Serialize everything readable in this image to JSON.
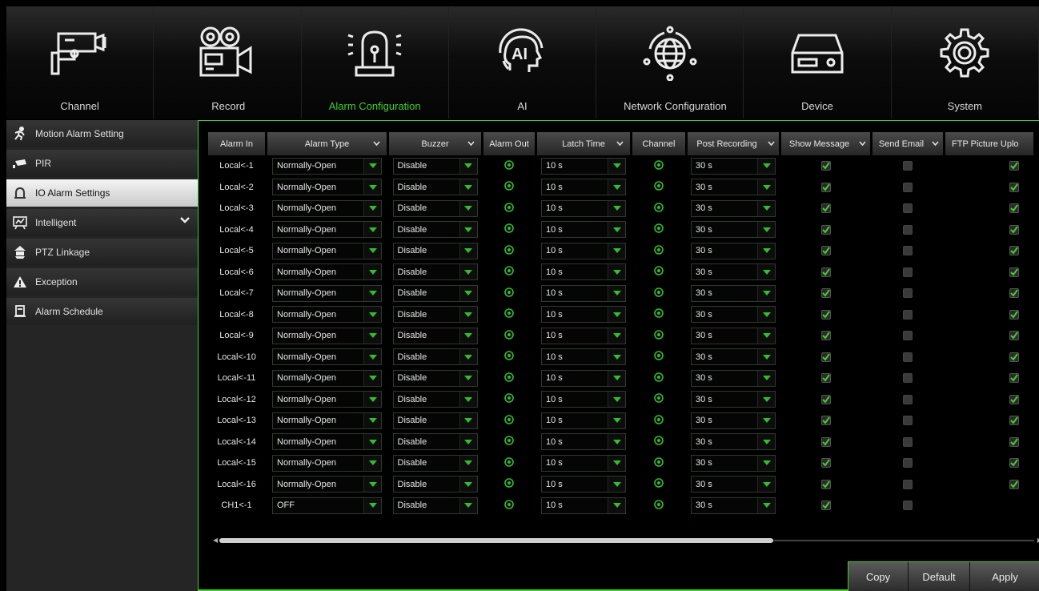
{
  "nav": {
    "tabs": [
      {
        "label": "Channel",
        "icon": "cctv-camera-icon"
      },
      {
        "label": "Record",
        "icon": "film-camera-icon"
      },
      {
        "label": "Alarm Configuration",
        "icon": "alarm-siren-icon"
      },
      {
        "label": "AI",
        "icon": "ai-head-icon"
      },
      {
        "label": "Network Configuration",
        "icon": "network-globe-icon"
      },
      {
        "label": "Device",
        "icon": "hard-drive-icon"
      },
      {
        "label": "System",
        "icon": "gear-icon"
      }
    ],
    "active": "Alarm Configuration",
    "accent": "#3fcf2a"
  },
  "sidebar": {
    "items": [
      {
        "label": "Motion Alarm Setting",
        "icon": "running-person-icon"
      },
      {
        "label": "PIR",
        "icon": "pir-sensor-icon"
      },
      {
        "label": "IO Alarm Settings",
        "icon": "io-alarm-icon"
      },
      {
        "label": "Intelligent",
        "icon": "intelligent-icon"
      },
      {
        "label": "PTZ Linkage",
        "icon": "ptz-icon"
      },
      {
        "label": "Exception",
        "icon": "warning-icon"
      },
      {
        "label": "Alarm Schedule",
        "icon": "schedule-icon"
      }
    ],
    "active": "IO Alarm Settings"
  },
  "table": {
    "headers": {
      "alarm_in": "Alarm In",
      "alarm_type": "Alarm Type",
      "buzzer": "Buzzer",
      "alarm_out": "Alarm Out",
      "latch_time": "Latch Time",
      "channel": "Channel",
      "post_recording": "Post Recording",
      "show_message": "Show Message",
      "send_email": "Send Email",
      "ftp_picture_upload": "FTP Picture Uplo"
    },
    "rows": [
      {
        "alarm_in": "Local<-1",
        "alarm_type": "Normally-Open",
        "buzzer": "Disable",
        "latch_time": "10 s",
        "post_recording": "30 s",
        "show_message": true,
        "send_email": false,
        "ftp": true
      },
      {
        "alarm_in": "Local<-2",
        "alarm_type": "Normally-Open",
        "buzzer": "Disable",
        "latch_time": "10 s",
        "post_recording": "30 s",
        "show_message": true,
        "send_email": false,
        "ftp": true
      },
      {
        "alarm_in": "Local<-3",
        "alarm_type": "Normally-Open",
        "buzzer": "Disable",
        "latch_time": "10 s",
        "post_recording": "30 s",
        "show_message": true,
        "send_email": false,
        "ftp": true
      },
      {
        "alarm_in": "Local<-4",
        "alarm_type": "Normally-Open",
        "buzzer": "Disable",
        "latch_time": "10 s",
        "post_recording": "30 s",
        "show_message": true,
        "send_email": false,
        "ftp": true
      },
      {
        "alarm_in": "Local<-5",
        "alarm_type": "Normally-Open",
        "buzzer": "Disable",
        "latch_time": "10 s",
        "post_recording": "30 s",
        "show_message": true,
        "send_email": false,
        "ftp": true
      },
      {
        "alarm_in": "Local<-6",
        "alarm_type": "Normally-Open",
        "buzzer": "Disable",
        "latch_time": "10 s",
        "post_recording": "30 s",
        "show_message": true,
        "send_email": false,
        "ftp": true
      },
      {
        "alarm_in": "Local<-7",
        "alarm_type": "Normally-Open",
        "buzzer": "Disable",
        "latch_time": "10 s",
        "post_recording": "30 s",
        "show_message": true,
        "send_email": false,
        "ftp": true
      },
      {
        "alarm_in": "Local<-8",
        "alarm_type": "Normally-Open",
        "buzzer": "Disable",
        "latch_time": "10 s",
        "post_recording": "30 s",
        "show_message": true,
        "send_email": false,
        "ftp": true
      },
      {
        "alarm_in": "Local<-9",
        "alarm_type": "Normally-Open",
        "buzzer": "Disable",
        "latch_time": "10 s",
        "post_recording": "30 s",
        "show_message": true,
        "send_email": false,
        "ftp": true
      },
      {
        "alarm_in": "Local<-10",
        "alarm_type": "Normally-Open",
        "buzzer": "Disable",
        "latch_time": "10 s",
        "post_recording": "30 s",
        "show_message": true,
        "send_email": false,
        "ftp": true
      },
      {
        "alarm_in": "Local<-11",
        "alarm_type": "Normally-Open",
        "buzzer": "Disable",
        "latch_time": "10 s",
        "post_recording": "30 s",
        "show_message": true,
        "send_email": false,
        "ftp": true
      },
      {
        "alarm_in": "Local<-12",
        "alarm_type": "Normally-Open",
        "buzzer": "Disable",
        "latch_time": "10 s",
        "post_recording": "30 s",
        "show_message": true,
        "send_email": false,
        "ftp": true
      },
      {
        "alarm_in": "Local<-13",
        "alarm_type": "Normally-Open",
        "buzzer": "Disable",
        "latch_time": "10 s",
        "post_recording": "30 s",
        "show_message": true,
        "send_email": false,
        "ftp": true
      },
      {
        "alarm_in": "Local<-14",
        "alarm_type": "Normally-Open",
        "buzzer": "Disable",
        "latch_time": "10 s",
        "post_recording": "30 s",
        "show_message": true,
        "send_email": false,
        "ftp": true
      },
      {
        "alarm_in": "Local<-15",
        "alarm_type": "Normally-Open",
        "buzzer": "Disable",
        "latch_time": "10 s",
        "post_recording": "30 s",
        "show_message": true,
        "send_email": false,
        "ftp": true
      },
      {
        "alarm_in": "Local<-16",
        "alarm_type": "Normally-Open",
        "buzzer": "Disable",
        "latch_time": "10 s",
        "post_recording": "30 s",
        "show_message": true,
        "send_email": false,
        "ftp": true
      },
      {
        "alarm_in": "CH1<-1",
        "alarm_type": "OFF",
        "buzzer": "Disable",
        "latch_time": "10 s",
        "post_recording": "30 s",
        "show_message": true,
        "send_email": false,
        "ftp": null
      }
    ]
  },
  "scroll": {
    "position": 0.0,
    "visible_fraction": 0.68
  },
  "buttons": {
    "copy": "Copy",
    "default": "Default",
    "apply": "Apply"
  },
  "colors": {
    "check_green": "#3fcf2a",
    "gear_green": "#2fbf2a"
  }
}
